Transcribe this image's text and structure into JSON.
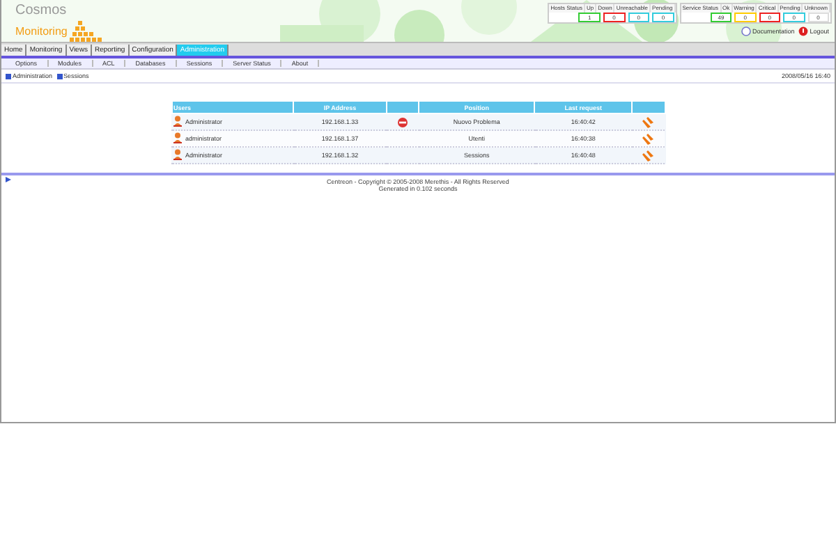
{
  "logo": {
    "line_1": "Cosmos",
    "line_2": "Monitoring"
  },
  "host_status": {
    "title": "Hosts Status",
    "cells": [
      {
        "label": "Up",
        "value": "1",
        "color": "#33cc33"
      },
      {
        "label": "Down",
        "value": "0",
        "color": "#ee2222"
      },
      {
        "label": "Unreachable",
        "value": "0",
        "color": "#33ccdd"
      },
      {
        "label": "Pending",
        "value": "0",
        "color": "#33ccdd"
      }
    ]
  },
  "service_status": {
    "title": "Service Status",
    "cells": [
      {
        "label": "Ok",
        "value": "49",
        "color": "#33cc33"
      },
      {
        "label": "Warning",
        "value": "0",
        "color": "#ffcc00"
      },
      {
        "label": "Critical",
        "value": "0",
        "color": "#ee2222"
      },
      {
        "label": "Pending",
        "value": "0",
        "color": "#33ccdd"
      },
      {
        "label": "Unknown",
        "value": "0",
        "color": "#dddddd"
      }
    ]
  },
  "top_links": [
    "Documentation",
    "Logout"
  ],
  "tabs": [
    {
      "label": "Home",
      "selected": false
    },
    {
      "label": "Monitoring",
      "selected": false
    },
    {
      "label": "Views",
      "selected": false
    },
    {
      "label": "Reporting",
      "selected": false
    },
    {
      "label": "Configuration",
      "selected": false
    },
    {
      "label": "Administration",
      "selected": true
    }
  ],
  "sub_menu": [
    "Options",
    "Modules",
    "ACL",
    "Databases",
    "Sessions",
    "Server Status",
    "About"
  ],
  "breadcrumb": [
    "Administration",
    "Sessions"
  ],
  "date": "2008/05/16 16:40",
  "table": {
    "columns": [
      "Users",
      "IP Address",
      "",
      "Position",
      "Last request",
      ""
    ],
    "rows": [
      {
        "user": "Administrator",
        "ip": "192.168.1.33",
        "flag": true,
        "position": "Nuovo Problema",
        "last_request": "16:40:42"
      },
      {
        "user": "administrator",
        "ip": "192.168.1.37",
        "flag": false,
        "position": "Utenti",
        "last_request": "16:40:38"
      },
      {
        "user": "Administrator",
        "ip": "192.168.1.32",
        "flag": false,
        "position": "Sessions",
        "last_request": "16:40:48"
      }
    ]
  },
  "footer": {
    "copyright": "Centreon - Copyright © 2005-2008 Merethis - All Rights Reserved",
    "generated": "Generated in 0.102 seconds"
  }
}
